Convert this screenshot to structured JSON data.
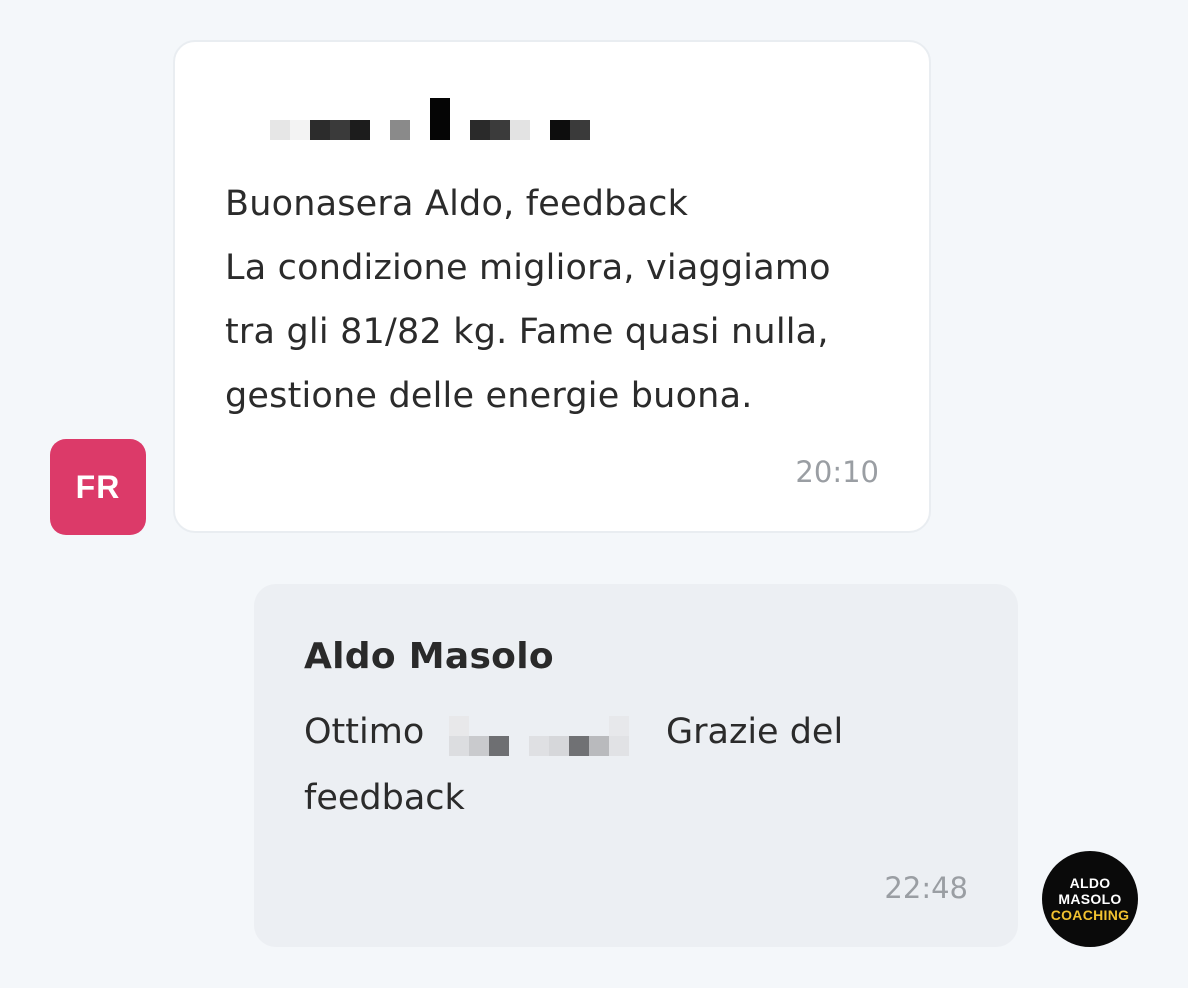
{
  "incoming": {
    "avatar_initials": "FR",
    "avatar_color": "#dc3a69",
    "sender_name_redacted": true,
    "text_lines": [
      "Buonasera Aldo, feedback",
      "La condizione migliora, viaggiamo",
      "tra gli 81/82 kg. Fame quasi nulla,",
      "gestione delle energie buona."
    ],
    "time": "20:10"
  },
  "outgoing": {
    "sender_name": "Aldo Masolo",
    "text_before_redaction": "Ottimo",
    "text_after_redaction": "Grazie del",
    "text_line2": "feedback",
    "time": "22:48",
    "avatar_logo": {
      "line1": "ALDO",
      "line2": "MASOLO",
      "line3": "COACHING",
      "accent_color": "#f2c230"
    }
  }
}
